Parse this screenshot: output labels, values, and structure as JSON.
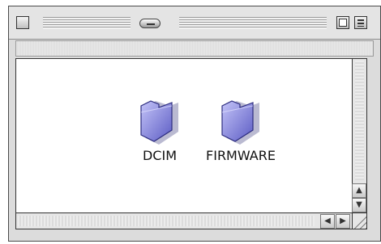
{
  "window": {
    "title": "",
    "items": [
      {
        "name": "DCIM",
        "icon": "folder-icon"
      },
      {
        "name": "FIRMWARE",
        "icon": "folder-icon"
      }
    ]
  },
  "colors": {
    "folder_top": "#b8b8f4",
    "folder_bottom": "#6b6bd0",
    "folder_outline": "#343488"
  },
  "scroll": {
    "up_glyph": "▲",
    "down_glyph": "▼",
    "left_glyph": "◀",
    "right_glyph": "▶"
  }
}
